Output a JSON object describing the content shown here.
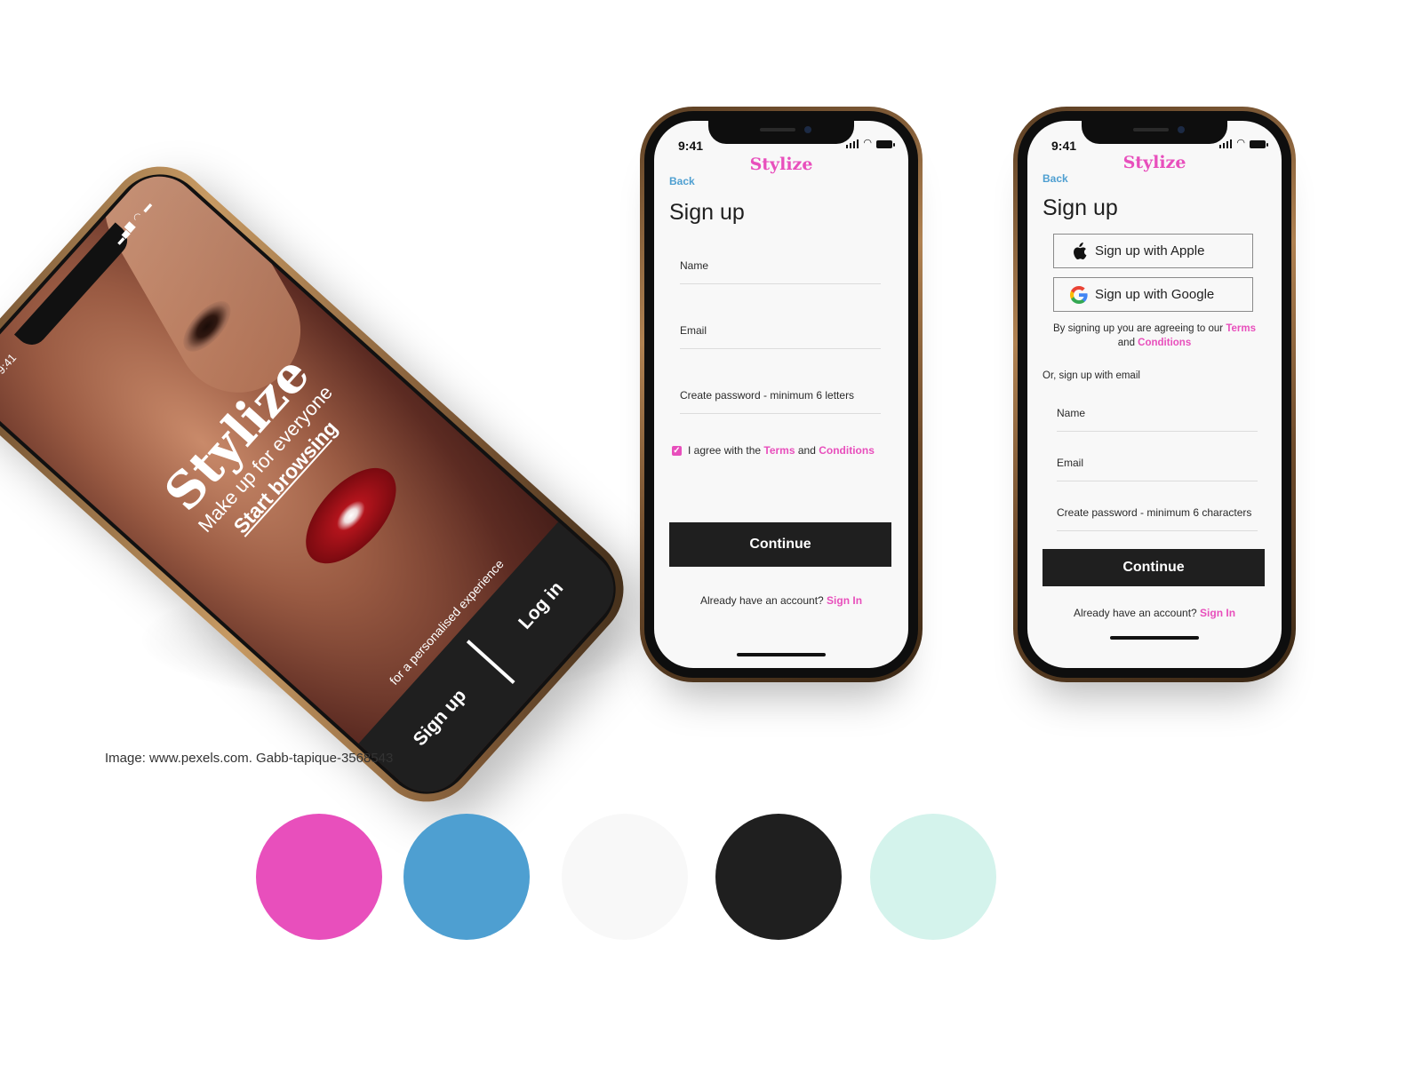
{
  "welcome_screen": {
    "time": "9:41",
    "brand": "Stylize",
    "tagline": "Make up for everyone",
    "browse_link": "Start browsing",
    "personalised_note": "for a personalised experience",
    "signup_label": "Sign up",
    "login_label": "Log in"
  },
  "signup_email_screen": {
    "time": "9:41",
    "brand": "Stylize",
    "back_label": "Back",
    "title": "Sign up",
    "name_placeholder": "Name",
    "email_placeholder": "Email",
    "password_placeholder": "Create password - minimum 6 letters",
    "agree_prefix": "I agree with the ",
    "terms_label": "Terms",
    "and_label": " and ",
    "conditions_label": "Conditions",
    "continue_label": "Continue",
    "already_text": "Already have an account? ",
    "signin_label": "Sign In"
  },
  "signup_social_screen": {
    "time": "9:41",
    "brand": "Stylize",
    "back_label": "Back",
    "title": "Sign up",
    "apple_label": "Sign up with Apple",
    "google_label": "Sign up with Google",
    "agree_text": "By signing up you are agreeing to our ",
    "terms_label": "Terms",
    "and_label": "and ",
    "conditions_label": "Conditions",
    "or_email_label": "Or, sign up with email",
    "name_placeholder": "Name",
    "email_placeholder": "Email",
    "password_placeholder": "Create password - minimum 6 characters",
    "continue_label": "Continue",
    "already_text": "Already have an account? ",
    "signin_label": "Sign In"
  },
  "caption": "Image: www.pexels.com. Gabb-tapique-3568543",
  "palette": [
    "#e84fbc",
    "#4e9fd1",
    "#f8f8f8",
    "#1f1f1f",
    "#d4f3ec"
  ],
  "icons": [
    "apple-icon",
    "google-icon",
    "signal-icon",
    "wifi-icon",
    "battery-icon",
    "check-icon"
  ]
}
